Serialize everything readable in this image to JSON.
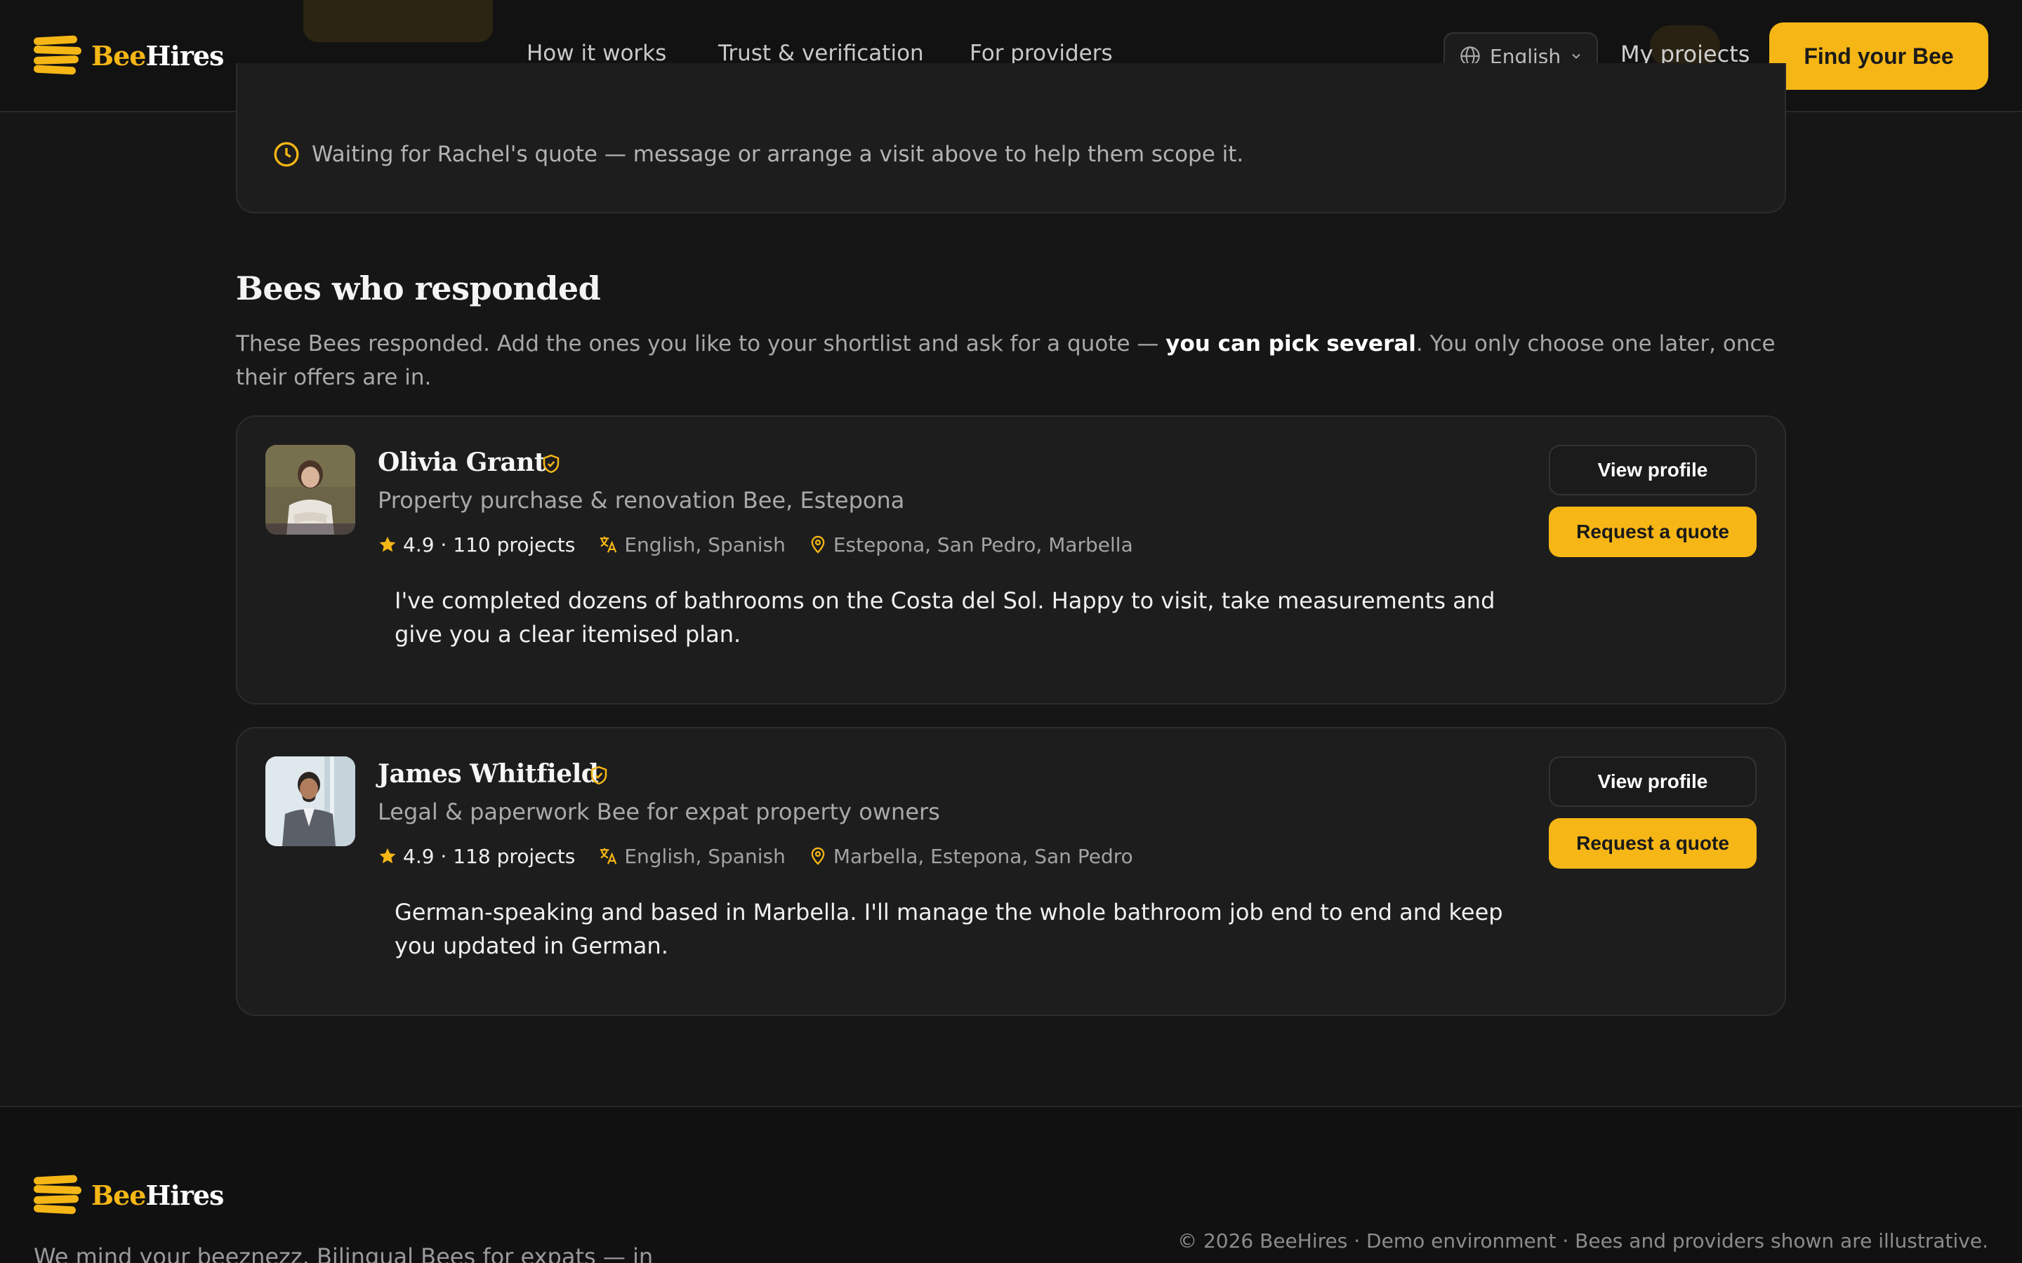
{
  "brand": {
    "name_part1": "Bee",
    "name_part2": "Hires",
    "accent": "#f5b616"
  },
  "header": {
    "nav": [
      "How it works",
      "Trust & verification",
      "For providers"
    ],
    "language": "English",
    "my_projects": "My projects",
    "cta": "Find your Bee"
  },
  "waiting": {
    "icon": "clock-icon",
    "text": "Waiting for Rachel's quote — message or arrange a visit above to help them scope it."
  },
  "section": {
    "title": "Bees who responded",
    "desc_before": "These Bees responded. Add the ones you like to your shortlist and ask for a quote — ",
    "desc_bold": "you can pick several",
    "desc_after": ". You only choose one later, once their offers are in."
  },
  "bees": [
    {
      "name": "Olivia Grant",
      "role": "Property purchase & renovation Bee, Estepona",
      "rating": "4.9 · 110 projects",
      "languages": "English, Spanish",
      "areas": "Estepona, San Pedro, Marbella",
      "quote": "I've completed dozens of bathrooms on the Costa del Sol. Happy to visit, take measurements and give you a clear itemised plan.",
      "view_label": "View profile",
      "quote_label": "Request a quote"
    },
    {
      "name": "James Whitfield",
      "role": "Legal & paperwork Bee for expat property owners",
      "rating": "4.9 · 118 projects",
      "languages": "English, Spanish",
      "areas": "Marbella, Estepona, San Pedro",
      "quote": "German-speaking and based in Marbella. I'll manage the whole bathroom job end to end and keep you updated in German.",
      "view_label": "View profile",
      "quote_label": "Request a quote"
    }
  ],
  "footer": {
    "tagline": "We mind your beeznezz. Bilingual Bees for expats — in",
    "copyright": "© 2026 BeeHires · Demo environment · Bees and providers shown are illustrative."
  }
}
